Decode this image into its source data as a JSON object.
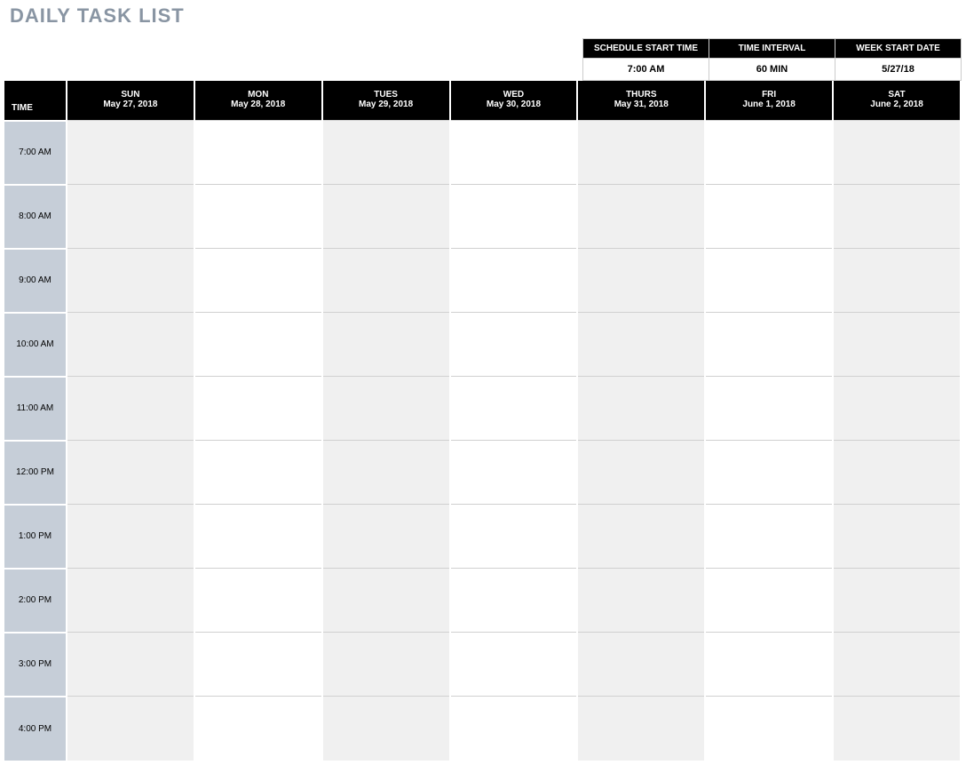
{
  "title": "DAILY TASK LIST",
  "settings": {
    "headers": {
      "start_time": "SCHEDULE START TIME",
      "interval": "TIME INTERVAL",
      "week_start": "WEEK START DATE"
    },
    "values": {
      "start_time": "7:00 AM",
      "interval": "60 MIN",
      "week_start": "5/27/18"
    }
  },
  "schedule": {
    "time_header": "TIME",
    "columns": [
      {
        "abbr": "SUN",
        "date": "May 27, 2018"
      },
      {
        "abbr": "MON",
        "date": "May 28, 2018"
      },
      {
        "abbr": "TUES",
        "date": "May 29, 2018"
      },
      {
        "abbr": "WED",
        "date": "May 30, 2018"
      },
      {
        "abbr": "THURS",
        "date": "May 31, 2018"
      },
      {
        "abbr": "FRI",
        "date": "June 1, 2018"
      },
      {
        "abbr": "SAT",
        "date": "June 2, 2018"
      }
    ],
    "rows": [
      "7:00 AM",
      "8:00 AM",
      "9:00 AM",
      "10:00 AM",
      "11:00 AM",
      "12:00 PM",
      "1:00 PM",
      "2:00 PM",
      "3:00 PM",
      "4:00 PM"
    ]
  }
}
